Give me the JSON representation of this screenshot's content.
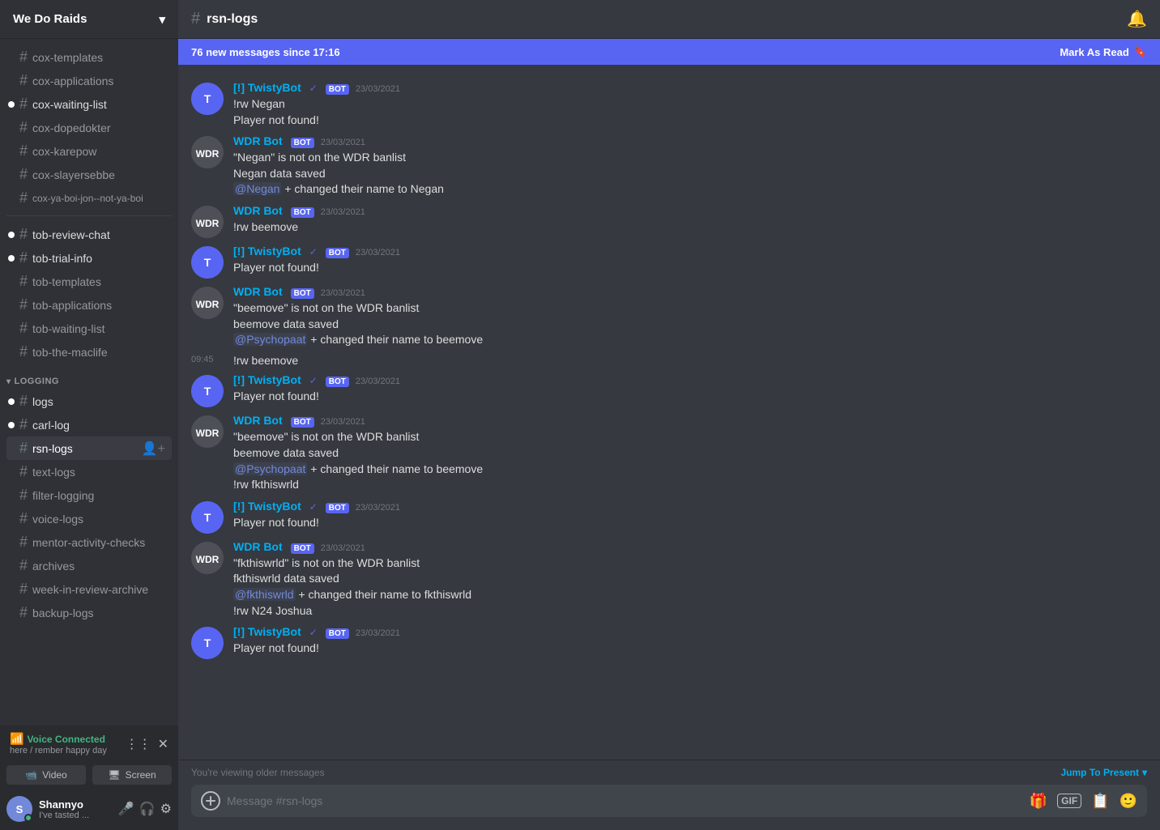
{
  "server": {
    "name": "We Do Raids",
    "chevron": "▾"
  },
  "channels": {
    "top_channels": [
      {
        "name": "cox-templates",
        "unread": false
      },
      {
        "name": "cox-applications",
        "unread": false
      },
      {
        "name": "cox-waiting-list",
        "unread": true
      },
      {
        "name": "cox-dopedokter",
        "unread": false
      },
      {
        "name": "cox-karepow",
        "unread": false
      },
      {
        "name": "cox-slayersebbe",
        "unread": false
      },
      {
        "name": "cox-ya-boi-jon--not-ya-boi",
        "unread": false
      }
    ],
    "tob_channels": [
      {
        "name": "tob-review-chat",
        "unread": true
      },
      {
        "name": "tob-trial-info",
        "unread": true
      },
      {
        "name": "tob-templates",
        "unread": false
      },
      {
        "name": "tob-applications",
        "unread": false
      },
      {
        "name": "tob-waiting-list",
        "unread": false
      },
      {
        "name": "tob-the-maclife",
        "unread": false
      }
    ],
    "logging_category": "LOGGING",
    "logging_channels": [
      {
        "name": "logs",
        "unread": true
      },
      {
        "name": "carl-log",
        "unread": true
      },
      {
        "name": "rsn-logs",
        "unread": false,
        "active": true
      },
      {
        "name": "text-logs",
        "unread": false
      },
      {
        "name": "filter-logging",
        "unread": false
      },
      {
        "name": "voice-logs",
        "unread": false
      },
      {
        "name": "mentor-activity-checks",
        "unread": false,
        "muted": true
      },
      {
        "name": "archives",
        "unread": false,
        "muted": true
      },
      {
        "name": "week-in-review-archive",
        "unread": false,
        "muted": true
      },
      {
        "name": "backup-logs",
        "unread": false,
        "muted": true
      }
    ]
  },
  "voice_connected": {
    "status": "Voice Connected",
    "channel": "here / rember happy day"
  },
  "video_screen": {
    "video_label": "Video",
    "screen_label": "Screen"
  },
  "user": {
    "name": "Shannyo",
    "status": "I've tasted ...",
    "initials": "S"
  },
  "header": {
    "channel_name": "rsn-logs",
    "hash": "#"
  },
  "new_messages_bar": {
    "text": "76 new messages since 17:16",
    "mark_read": "Mark As Read",
    "bookmark_icon": "🔖"
  },
  "messages": [
    {
      "id": 1,
      "type": "group",
      "avatar_type": "twisty",
      "username": "[!] TwistyBot",
      "username_class": "twisty",
      "verified": true,
      "bot": true,
      "timestamp": "23/03/2021",
      "lines": [
        "!rw Negan",
        "Player not found!"
      ]
    },
    {
      "id": 2,
      "type": "group",
      "avatar_type": "wdrbot",
      "username": "WDR Bot",
      "username_class": "wdrbot",
      "bot": true,
      "timestamp": "23/03/2021",
      "lines": [
        "\"Negan\" is not on the WDR banlist",
        "Negan data saved",
        "@Negan + changed their name to Negan"
      ],
      "has_mention": {
        "line": 2,
        "mention": "@Negan",
        "rest": " + changed their name to Negan"
      }
    },
    {
      "id": 3,
      "type": "group",
      "avatar_type": "wdrbot",
      "username": "WDR Bot",
      "username_class": "wdrbot",
      "bot": true,
      "timestamp": "23/03/2021",
      "lines": [
        "!rw beemove"
      ]
    },
    {
      "id": 4,
      "type": "group",
      "avatar_type": "twisty",
      "username": "[!] TwistyBot",
      "username_class": "twisty",
      "verified": true,
      "bot": true,
      "timestamp": "23/03/2021",
      "lines": [
        "Player not found!"
      ]
    },
    {
      "id": 5,
      "type": "group",
      "avatar_type": "wdrbot",
      "username": "WDR Bot",
      "username_class": "wdrbot",
      "bot": true,
      "timestamp": "23/03/2021",
      "lines": [
        "\"beemove\" is not on the WDR banlist",
        "beemove data saved",
        "@Psychopaat + changed their name to beemove"
      ],
      "mention_line": 2,
      "mention_text": "@Psychopaat",
      "mention_rest": " + changed their name to beemove"
    },
    {
      "id": 6,
      "type": "continued",
      "timestamp_left": "09:45",
      "lines": [
        "!rw beemove"
      ]
    },
    {
      "id": 7,
      "type": "group",
      "avatar_type": "twisty",
      "username": "[!] TwistyBot",
      "username_class": "twisty",
      "verified": true,
      "bot": true,
      "timestamp": "23/03/2021",
      "lines": [
        "Player not found!"
      ]
    },
    {
      "id": 8,
      "type": "group",
      "avatar_type": "wdrbot",
      "username": "WDR Bot",
      "username_class": "wdrbot",
      "bot": true,
      "timestamp": "23/03/2021",
      "lines": [
        "\"beemove\" is not on the WDR banlist",
        "beemove data saved",
        "@Psychopaat + changed their name to beemove",
        "!rw fkthiswrld"
      ],
      "mention_line": 2,
      "mention_text": "@Psychopaat",
      "mention_rest": " + changed their name to beemove"
    },
    {
      "id": 9,
      "type": "group",
      "avatar_type": "twisty",
      "username": "[!] TwistyBot",
      "username_class": "twisty",
      "verified": true,
      "bot": true,
      "timestamp": "23/03/2021",
      "lines": [
        "Player not found!"
      ]
    },
    {
      "id": 10,
      "type": "group",
      "avatar_type": "wdrbot",
      "username": "WDR Bot",
      "username_class": "wdrbot",
      "bot": true,
      "timestamp": "23/03/2021",
      "lines": [
        "\"fkthiswrld\" is not on the WDR banlist",
        "fkthiswrld data saved",
        "@fkthiswrld + changed their name to fkthiswrld",
        "!rw N24 Joshua"
      ],
      "mention_line": 2,
      "mention_text": "@fkthiswrld",
      "mention_rest": " + changed their name to fkthiswrld"
    },
    {
      "id": 11,
      "type": "group",
      "avatar_type": "twisty",
      "username": "[!] TwistyBot",
      "username_class": "twisty",
      "verified": true,
      "bot": true,
      "timestamp": "23/03/2021",
      "lines": [
        "Player not found!"
      ]
    }
  ],
  "older_messages_bar": {
    "text": "You're viewing older messages",
    "jump_label": "Jump To Present",
    "chevron": "▾"
  },
  "message_input": {
    "placeholder": "Message #rsn-logs"
  },
  "icons": {
    "hash": "#",
    "bell": "🔔",
    "plus": "+",
    "gift": "🎁",
    "gif": "GIF",
    "sticker": "📋",
    "emoji": "🙂",
    "mic": "🎤",
    "headphones": "🎧",
    "settings": "⚙",
    "signal_bars": "📶",
    "disconnect": "📵"
  }
}
